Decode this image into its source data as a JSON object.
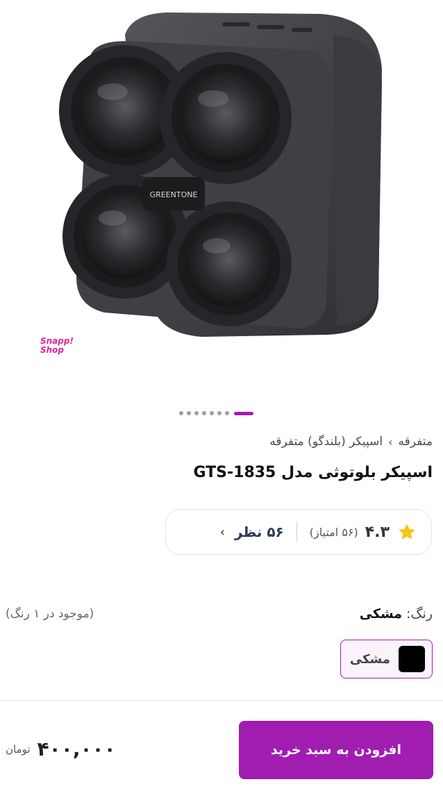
{
  "product": {
    "image_alt": "Bluetooth speaker with four circular drivers",
    "brand_text": "GREENTONE",
    "watermark": [
      "Snapp!",
      "Shop"
    ],
    "carousel": {
      "count": 8,
      "active_index": 7
    }
  },
  "breadcrumb": {
    "items": [
      "متفرقه",
      "اسپیکر (بلندگو) متفرقه"
    ],
    "separator": "›"
  },
  "title": "اسپیکر بلوتوثی مدل GTS-1835",
  "rating": {
    "value": "۴.۳",
    "count_text": "(۵۶ امتیاز)",
    "reviews_text": "۵۶ نظر",
    "chevron": "›",
    "star_color": "#f5c518"
  },
  "color": {
    "label": "رنگ:",
    "selected": "مشکی",
    "stock_info": "(موجود در ۱ رنگ)",
    "options": [
      {
        "label": "مشکی",
        "hex": "#000000"
      }
    ]
  },
  "cart": {
    "add_button_label": "افزودن به سبد خرید",
    "price": "۴۰۰,۰۰۰",
    "currency": "تومان"
  },
  "theme": {
    "accent": "#a01db0"
  }
}
